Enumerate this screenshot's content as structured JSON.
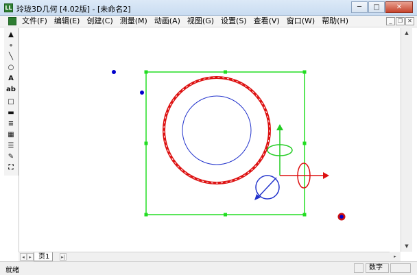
{
  "window": {
    "title": "玲珑3D几何 [4.02版] - [未命名2]",
    "app_icon": "app-logo-icon",
    "controls": {
      "minimize": "─",
      "maximize": "□",
      "close": "✕"
    }
  },
  "menubar": {
    "items": [
      "文件(F)",
      "编辑(E)",
      "创建(C)",
      "测量(M)",
      "动画(A)",
      "视图(G)",
      "设置(S)",
      "查看(V)",
      "窗口(W)",
      "帮助(H)"
    ],
    "mdi_controls": {
      "minimize": "_",
      "restore": "❐",
      "close": "✕"
    }
  },
  "toolbox": {
    "tools": [
      {
        "name": "select-arrow-icon",
        "glyph": "▲"
      },
      {
        "name": "point-tool-icon",
        "glyph": "∘"
      },
      {
        "name": "line-tool-icon",
        "glyph": "╲"
      },
      {
        "name": "circle-tool-icon",
        "glyph": "○"
      },
      {
        "name": "text-tool-icon",
        "glyph": "A"
      },
      {
        "name": "label-tool-icon",
        "glyph": "ab"
      },
      {
        "name": "rectangle-tool-icon",
        "glyph": "□"
      },
      {
        "name": "bold-lines-tool-icon",
        "glyph": "▬"
      },
      {
        "name": "parallel-lines-tool-icon",
        "glyph": "≡"
      },
      {
        "name": "grid-tool-icon",
        "glyph": "▦"
      },
      {
        "name": "stack-tool-icon",
        "glyph": "☰"
      },
      {
        "name": "pencil-tool-icon",
        "glyph": "✎"
      },
      {
        "name": "graph-tool-icon",
        "glyph": "⛶"
      }
    ]
  },
  "canvas": {
    "colors": {
      "bounding_box": "#22dd22",
      "outer_ring": "#dd1111",
      "inner_circle": "#2233cc",
      "axis_y": "#22cc22",
      "axis_x": "#dd1111",
      "rotation_handle": "#2233cc",
      "point": "#0000cc"
    }
  },
  "page_tabs": {
    "nav": [
      "|◂",
      "◂",
      "▸",
      "▸|"
    ],
    "tabs": [
      "页1"
    ]
  },
  "statusbar": {
    "left": "就绪",
    "mode": "数字"
  }
}
